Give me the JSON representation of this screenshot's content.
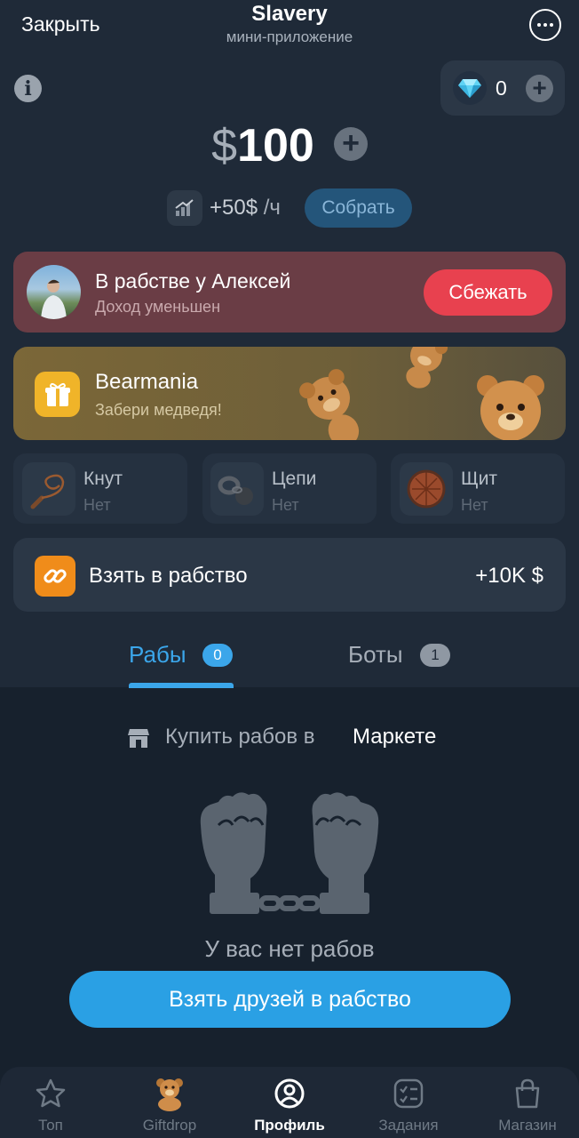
{
  "header": {
    "close_label": "Закрыть",
    "title": "Slavery",
    "subtitle": "мини-приложение"
  },
  "gems": {
    "count": "0"
  },
  "balance": {
    "currency": "$",
    "amount": "100"
  },
  "income": {
    "amount": "+50$",
    "per": " /ч",
    "collect_label": "Собрать"
  },
  "owner": {
    "title": "В рабстве у Алексей",
    "subtitle": "Доход уменьшен",
    "escape_label": "Сбежать"
  },
  "promo": {
    "title": "Bearmania",
    "subtitle": "Забери медведя!"
  },
  "items": [
    {
      "name": "Кнут",
      "value": "Нет"
    },
    {
      "name": "Цепи",
      "value": "Нет"
    },
    {
      "name": "Щит",
      "value": "Нет"
    }
  ],
  "enslave": {
    "label": "Взять в рабство",
    "reward": "+10K $"
  },
  "tabs": [
    {
      "label": "Рабы",
      "count": "0"
    },
    {
      "label": "Боты",
      "count": "1"
    }
  ],
  "market": {
    "prefix": "Купить рабов в",
    "link": "Маркете"
  },
  "empty": {
    "text": "У вас нет рабов",
    "button": "Взять друзей в рабство"
  },
  "nav": [
    {
      "label": "Топ"
    },
    {
      "label": "Giftdrop"
    },
    {
      "label": "Профиль"
    },
    {
      "label": "Задания"
    },
    {
      "label": "Магазин"
    }
  ],
  "colors": {
    "background": "#1f2a38",
    "accent": "#3ba6ea",
    "danger": "#e8414f",
    "owner_card": "#6a3d45"
  }
}
